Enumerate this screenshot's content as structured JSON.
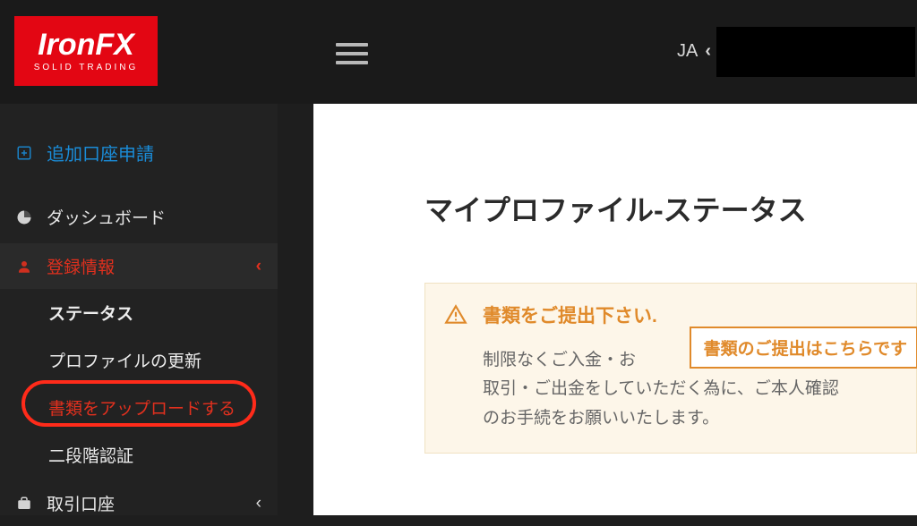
{
  "header": {
    "logo_brand": "IronFX",
    "logo_tagline": "SOLID TRADING",
    "lang_label": "JA"
  },
  "sidebar": {
    "add_account": "追加口座申請",
    "dashboard": "ダッシュボード",
    "registration": "登録情報",
    "sub": {
      "status": "ステータス",
      "profile_update": "プロファイルの更新",
      "upload_docs": "書類をアップロードする",
      "two_factor": "二段階認証"
    },
    "trade_account": "取引口座"
  },
  "main": {
    "title": "マイプロファイル-ステータス",
    "notice_title": "書類をご提出下さい.",
    "notice_body_l1": "制限なくご入金・お",
    "notice_body_l2": "取引・ご出金をしていただく為に、ご本人確認",
    "notice_body_l3": "のお手続をお願いいたします。",
    "submit_button": "書類のご提出はこちらです"
  }
}
